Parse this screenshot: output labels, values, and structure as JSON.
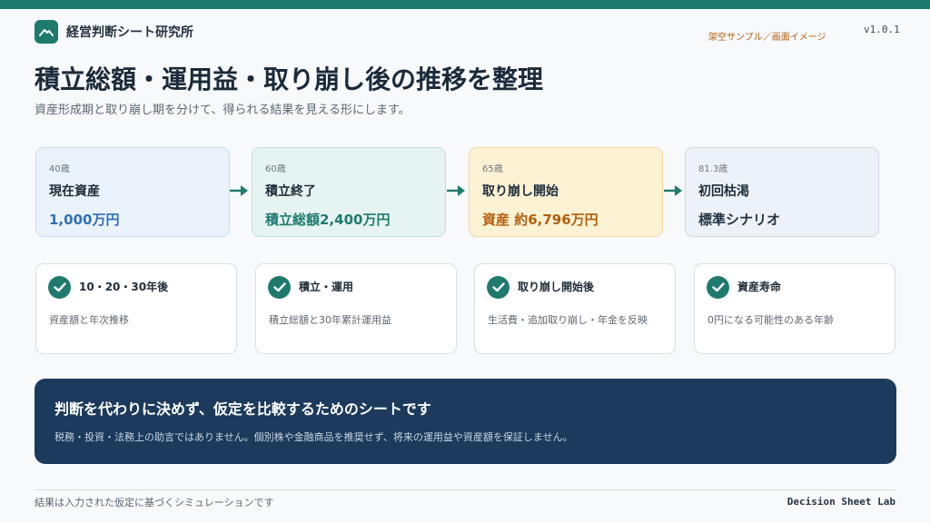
{
  "brand": {
    "name": "経営判断シート研究所",
    "logo_icon": "mountain-icon"
  },
  "header": {
    "sample_label": "架空サンプル／画面イメージ",
    "version": "v1.0.1"
  },
  "page": {
    "title": "積立総額・運用益・取り崩し後の推移を整理",
    "subtitle": "資産形成期と取り崩し期を分けて、得られる結果を見える形にします。"
  },
  "stages": [
    {
      "age": "40歳",
      "name": "現在資産",
      "value": "1,000万円"
    },
    {
      "age": "60歳",
      "name": "積立終了",
      "value": "積立総額2,400万円"
    },
    {
      "age": "65歳",
      "name": "取り崩し開始",
      "value": "資産 約6,796万円"
    },
    {
      "age": "81.3歳",
      "name": "初回枯渇",
      "value": "標準シナリオ"
    }
  ],
  "features": [
    {
      "title": "10・20・30年後",
      "desc": "資産額と年次推移"
    },
    {
      "title": "積立・運用",
      "desc": "積立総額と30年累計運用益"
    },
    {
      "title": "取り崩し開始後",
      "desc": "生活費・追加取り崩し・年金を反映"
    },
    {
      "title": "資産寿命",
      "desc": "0円になる可能性のある年齢"
    }
  ],
  "notice": {
    "title": "判断を代わりに決めず、仮定を比較するためのシートです",
    "desc": "税務・投資・法務上の助言ではありません。個別株や金融商品を推奨せず、将来の運用益や資産額を保証しません。"
  },
  "footer": {
    "left": "結果は入力された仮定に基づくシミュレーションです",
    "right": "Decision Sheet Lab"
  },
  "colors": {
    "accent": "#1f7a6e",
    "navy": "#1b3a5c",
    "blue": "#2f6fb8",
    "orange": "#b45f0d"
  }
}
